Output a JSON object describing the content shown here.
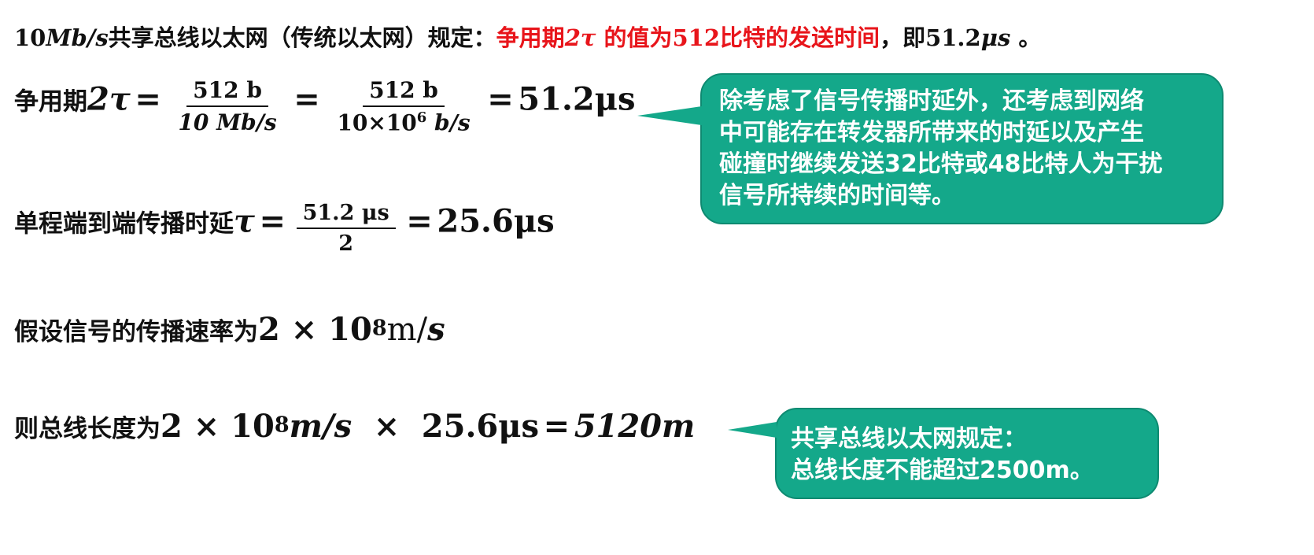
{
  "title": {
    "part1": "10",
    "part1_unit": "Mb/s",
    "part2": "共享总线以太网（传统以太网）规定：",
    "red1": "争用期",
    "red_math": "2τ",
    "red2": " 的值为",
    "red_num": "512",
    "red3": "比特的发送时间",
    "part3": "，即",
    "value": "51.2",
    "unit": "μs",
    "end": " 。"
  },
  "contention": {
    "label": "争用期",
    "lhs": "2τ",
    "eq1": "=",
    "frac1_num": "512 b",
    "frac1_den": "10 Mb/s",
    "eq2": "=",
    "frac2_num": "512 b",
    "frac2_den_a": "10×10",
    "frac2_den_exp": "6",
    "frac2_den_b": " b/s",
    "eq3": "=",
    "result": "51.2μs"
  },
  "oneway": {
    "label": "单程端到端传播时延",
    "lhs": "τ",
    "eq1": "=",
    "frac_num": "51.2 μs",
    "frac_den": "2",
    "eq2": "=",
    "result": "25.6μs"
  },
  "speed": {
    "label": "假设信号的传播速率为",
    "mantissa": "2 × 10",
    "exp": "8",
    "unit_m": "m/",
    "unit_s": "s"
  },
  "length": {
    "label": "则总线长度为",
    "mantissa": "2 × 10",
    "exp": "8",
    "unit": "m/s",
    "times": "×",
    "delay": "25.6μs",
    "eq": "=",
    "result": "5120m"
  },
  "callout1": {
    "lines": [
      "除考虑了信号传播时延外，还考虑到网络",
      "中可能存在转发器所带来的时延以及产生",
      "碰撞时继续发送32比特或48比特人为干扰",
      "信号所持续的时间等。"
    ]
  },
  "callout2": {
    "lines": [
      "共享总线以太网规定：",
      "总线长度不能超过2500m。"
    ]
  },
  "colors": {
    "highlight_red": "#e8151b",
    "callout_green": "#14a88a",
    "text": "#111111"
  }
}
